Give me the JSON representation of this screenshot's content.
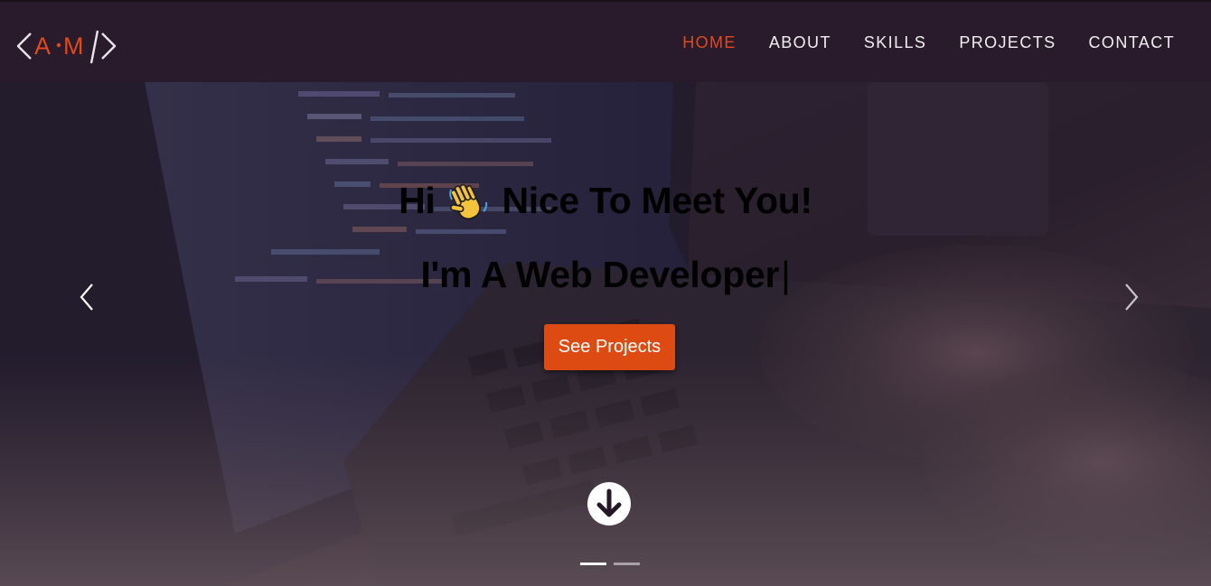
{
  "logo": {
    "text": "<A·M/>",
    "letters": [
      "A",
      "M"
    ],
    "colors": {
      "bracket": "#e8e4e8",
      "letter": "#dd4a1e"
    }
  },
  "nav": {
    "items": [
      {
        "label": "HOME",
        "active": true
      },
      {
        "label": "ABOUT",
        "active": false
      },
      {
        "label": "SKILLS",
        "active": false
      },
      {
        "label": "PROJECTS",
        "active": false
      },
      {
        "label": "CONTACT",
        "active": false
      }
    ],
    "colors": {
      "active": "#dd4a1e",
      "default": "#f1eef2"
    }
  },
  "hero": {
    "greeting_before": "Hi",
    "greeting_icon": "waving-hand-icon",
    "greeting_after": "Nice To Meet You!",
    "tagline": "I'm A Web Developer",
    "cursor": "|",
    "cta_label": "See Projects",
    "cta_color": "#dd4a12",
    "background_image": "laptop-code-keyboard-photo",
    "prev_icon": "chevron-left-icon",
    "next_icon": "chevron-right-icon",
    "scroll_icon": "arrow-down-circle-icon",
    "carousel": {
      "slide_count": 2,
      "active_index": 0
    }
  },
  "colors": {
    "navbar": "#2a1b2c",
    "overlay": "#2b1f2e",
    "text": "#ffffff"
  }
}
